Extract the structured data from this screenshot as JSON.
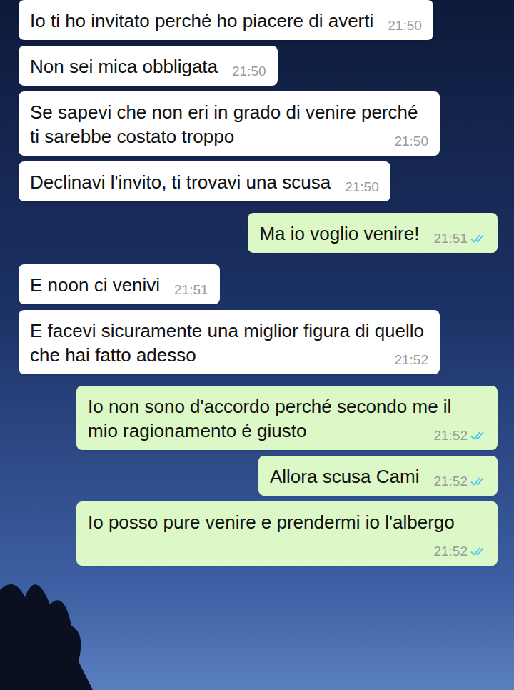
{
  "chat": {
    "messages": [
      {
        "kind": "incoming",
        "text": "Io ti ho invitato perché ho piacere di averti",
        "time": "21:50"
      },
      {
        "kind": "incoming",
        "text": "Non sei mica obbligata",
        "time": "21:50"
      },
      {
        "kind": "incoming",
        "text": "Se sapevi che non eri in grado di venire perché ti sarebbe costato troppo",
        "time": "21:50"
      },
      {
        "kind": "incoming",
        "text": "Declinavi l'invito, ti trovavi una scusa",
        "time": "21:50"
      },
      {
        "kind": "outgoing",
        "text": "Ma io voglio venire!",
        "time": "21:51",
        "read": true
      },
      {
        "kind": "incoming",
        "text": "E noon ci venivi",
        "time": "21:51"
      },
      {
        "kind": "incoming",
        "text": "E facevi sicuramente una miglior figura di quello che hai fatto adesso",
        "time": "21:52"
      },
      {
        "kind": "outgoing",
        "text": "Io non sono d'accordo perché secondo me il mio ragionamento é giusto",
        "time": "21:52",
        "read": true
      },
      {
        "kind": "outgoing",
        "text": "Allora scusa Cami",
        "time": "21:52",
        "read": true
      },
      {
        "kind": "outgoing",
        "text": "Io posso pure venire e prendermi io l'albergo",
        "time": "21:52",
        "read": true
      }
    ]
  }
}
